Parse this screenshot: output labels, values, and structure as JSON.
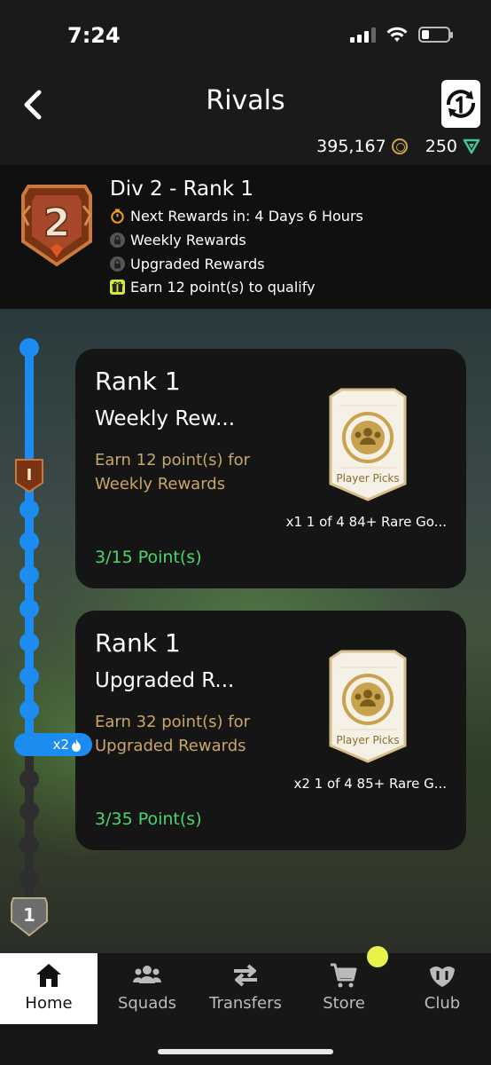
{
  "status_bar": {
    "time": "7:24"
  },
  "header": {
    "title": "Rivals",
    "coins": "395,167",
    "points": "250",
    "coin_icon_text": "UT"
  },
  "division": {
    "badge_number": "2",
    "title": "Div 2 - Rank 1",
    "next_rewards": "Next Rewards in: 4 Days 6 Hours",
    "weekly_rewards": "Weekly Rewards",
    "upgraded_rewards": "Upgraded Rewards",
    "qualify": "Earn 12 point(s) to qualify"
  },
  "track": {
    "marker_rank": "I",
    "bottom_badge": "1",
    "multiplier": "x2"
  },
  "cards": [
    {
      "rank": "Rank 1",
      "name": "Weekly Rew...",
      "description": "Earn 12 point(s) for Weekly Rewards",
      "pack_label": "Player Picks",
      "pack_description": "x1 1 of 4 84+ Rare Go...",
      "points": "3/15 Point(s)"
    },
    {
      "rank": "Rank 1",
      "name": "Upgraded R...",
      "description": "Earn 32 point(s) for Upgraded Rewards",
      "pack_label": "Player Picks",
      "pack_description": "x2 1 of 4 85+ Rare G...",
      "points": "3/35 Point(s)"
    }
  ],
  "tabbar": {
    "home": "Home",
    "squads": "Squads",
    "transfers": "Transfers",
    "store": "Store",
    "club": "Club"
  },
  "colors": {
    "accent_blue": "#1d8cf0",
    "gold_text": "#c8a668",
    "green_points": "#4ad66d",
    "store_dot": "#e6f14a"
  }
}
